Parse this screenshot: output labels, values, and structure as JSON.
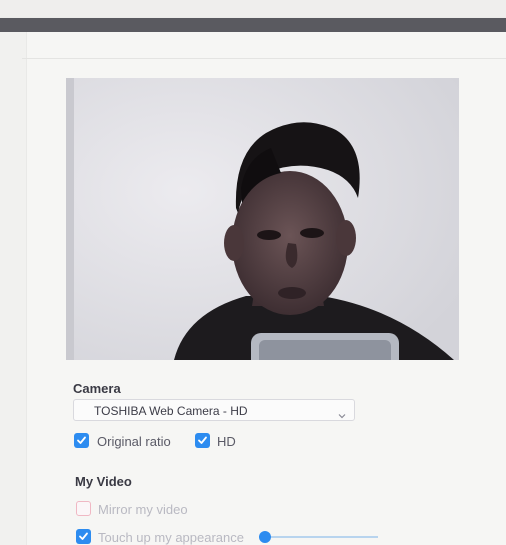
{
  "camera": {
    "section_title": "Camera",
    "selected_camera": "TOSHIBA Web Camera - HD",
    "original_ratio_label": "Original ratio",
    "original_ratio_checked": true,
    "hd_label": "HD",
    "hd_checked": true
  },
  "my_video": {
    "section_title": "My Video",
    "mirror_label": "Mirror my video",
    "mirror_checked": false,
    "touch_up_label": "Touch up my appearance",
    "touch_up_checked": true,
    "touch_up_level": 0.0
  },
  "colors": {
    "accent": "#2d8cf0",
    "top_bar": "#5a5a60"
  },
  "icons": {
    "select_arrow": "chevron-down-icon",
    "checkbox_check": "checkmark-icon"
  }
}
